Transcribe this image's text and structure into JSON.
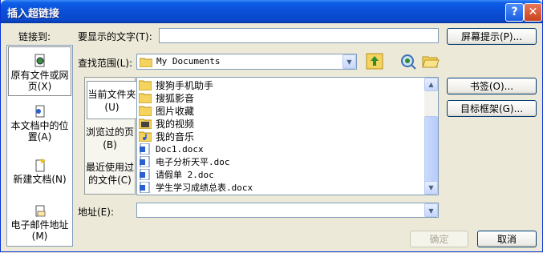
{
  "window": {
    "title": "插入超链接",
    "help_glyph": "?",
    "close_glyph": "✕"
  },
  "form": {
    "display_text_label": "要显示的文字(T):",
    "display_text_value": "",
    "screentip_button": "屏幕提示(P)...",
    "lookin_label": "查找范围(L):",
    "lookin_value": "My Documents",
    "address_label": "地址(E):",
    "address_value": "",
    "bookmark_button": "书签(O)...",
    "target_frame_button": "目标框架(G)...",
    "ok_button": "确定",
    "cancel_button": "取消"
  },
  "linkbar": {
    "title": "链接到:",
    "items": [
      {
        "label": "原有文件或网页(X)",
        "icon": "globe-page-icon",
        "selected": true
      },
      {
        "label": "本文档中的位置(A)",
        "icon": "document-place-icon",
        "selected": false
      },
      {
        "label": "新建文档(N)",
        "icon": "new-document-icon",
        "selected": false
      },
      {
        "label": "电子邮件地址(M)",
        "icon": "email-icon",
        "selected": false
      }
    ]
  },
  "tabs": [
    {
      "label": "当前文件夹(U)",
      "active": true
    },
    {
      "label": "浏览过的页(B)",
      "active": false
    },
    {
      "label": "最近使用过的文件(C)",
      "active": false
    }
  ],
  "files": [
    {
      "name": "搜狗手机助手",
      "icon": "folder-icon"
    },
    {
      "name": "搜狐影音",
      "icon": "folder-icon"
    },
    {
      "name": "图片收藏",
      "icon": "folder-icon"
    },
    {
      "name": "我的视频",
      "icon": "video-folder-icon"
    },
    {
      "name": "我的音乐",
      "icon": "music-folder-icon"
    },
    {
      "name": "Doc1.docx",
      "icon": "word-doc-icon"
    },
    {
      "name": "电子分析天平.doc",
      "icon": "word-doc-icon"
    },
    {
      "name": "请假单 2.doc",
      "icon": "word-doc-icon"
    },
    {
      "name": "学生学习成绩总表.docx",
      "icon": "word-doc-icon"
    }
  ],
  "toolbar_icons": [
    "up-folder-icon",
    "search-web-icon",
    "open-folder-icon"
  ]
}
